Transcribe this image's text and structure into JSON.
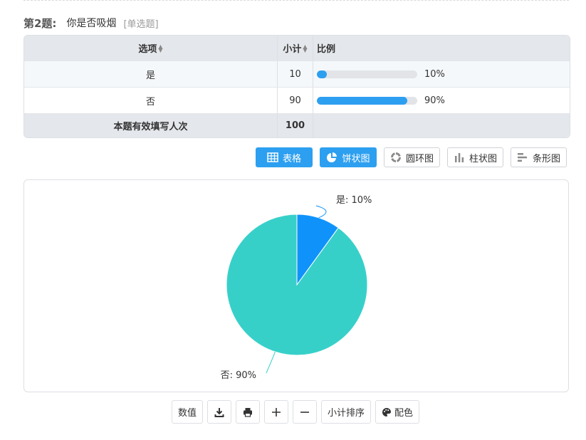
{
  "question": {
    "number": "第2题:",
    "title": "你是否吸烟",
    "type": "[单选题]"
  },
  "table": {
    "headers": {
      "option": "选项",
      "count": "小计",
      "ratio": "比例"
    },
    "rows": [
      {
        "option": "是",
        "count": "10",
        "percent": "10%",
        "fraction": 0.1
      },
      {
        "option": "否",
        "count": "90",
        "percent": "90%",
        "fraction": 0.9
      }
    ],
    "total_label": "本题有效填写人次",
    "total_value": "100"
  },
  "view_buttons": [
    {
      "label": "表格",
      "icon": "table-icon",
      "active": true
    },
    {
      "label": "饼状图",
      "icon": "pie-icon",
      "active": true
    },
    {
      "label": "圆环图",
      "icon": "donut-icon",
      "active": false
    },
    {
      "label": "柱状图",
      "icon": "column-chart-icon",
      "active": false
    },
    {
      "label": "条形图",
      "icon": "bar-chart-icon",
      "active": false
    }
  ],
  "chart_data": {
    "type": "pie",
    "categories": [
      "是",
      "否"
    ],
    "values": [
      10,
      90
    ],
    "data_labels": [
      "是: 10%",
      "否: 90%"
    ],
    "colors": [
      "#0f93fb",
      "#37d0c9"
    ]
  },
  "tools": {
    "values_label": "数值",
    "download_icon": "download-icon",
    "print_icon": "print-icon",
    "zoom_in_icon": "plus-icon",
    "zoom_out_icon": "minus-icon",
    "sort_label": "小计排序",
    "color_label": "配色",
    "color_icon": "palette-icon"
  },
  "colors": {
    "accent": "#2d9ff0",
    "header_bg": "#e4e7eb"
  }
}
